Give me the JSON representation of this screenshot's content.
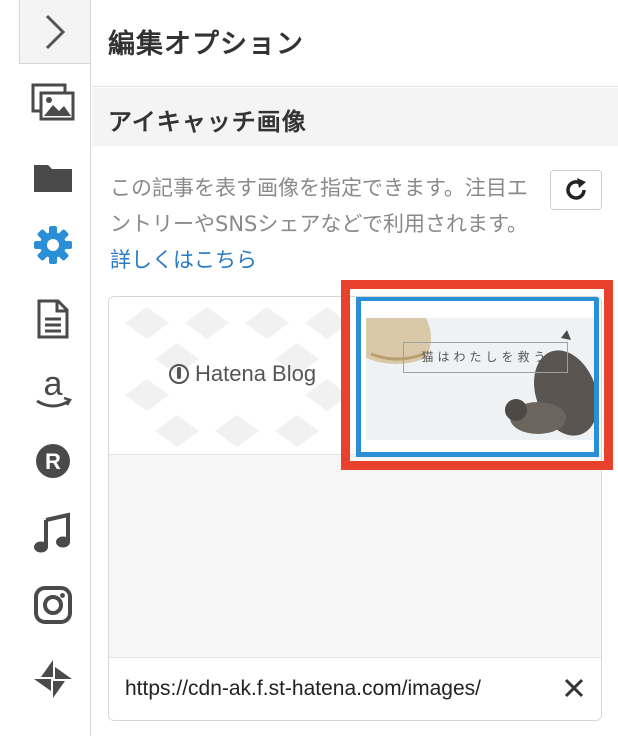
{
  "sidebar": {
    "collapse_icon": "chevron-right-icon",
    "items": [
      {
        "icon": "photos-icon",
        "active": false
      },
      {
        "icon": "folder-icon",
        "active": false
      },
      {
        "icon": "gear-icon",
        "active": true
      },
      {
        "icon": "document-icon",
        "active": false
      },
      {
        "icon": "amazon-icon",
        "active": false
      },
      {
        "icon": "rakuten-icon",
        "active": false
      },
      {
        "icon": "music-note-icon",
        "active": false
      },
      {
        "icon": "instagram-icon",
        "active": false
      },
      {
        "icon": "pinwheel-icon",
        "active": false
      },
      {
        "icon": "chevron-down-icon",
        "active": false
      }
    ],
    "colors": {
      "icon": "#4a4a4a",
      "active": "#2b8fd8"
    }
  },
  "panel": {
    "title": "編集オプション"
  },
  "eyecatch": {
    "section_title": "アイキャッチ画像",
    "description": "この記事を表す画像を指定できます。注目エントリーやSNSシェアなどで利用されます。",
    "details_link": "詳しくはこちら",
    "refresh_icon": "refresh-icon",
    "thumbnails": [
      {
        "label": "Hatena Blog",
        "selected": false
      },
      {
        "label": "猫はわたしを救う",
        "selected": true
      }
    ],
    "url_value": "https://cdn-ak.f.st-hatena.com/images/",
    "clear_icon": "close-icon",
    "colors": {
      "selected_border": "#2b8fd8",
      "highlight": "#e8412c",
      "link": "#2a7bc6"
    }
  }
}
